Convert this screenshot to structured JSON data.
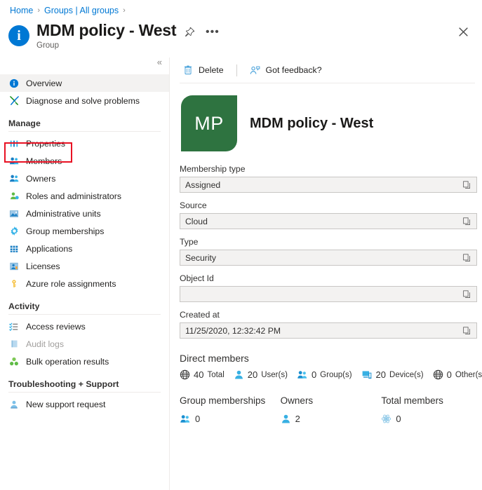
{
  "breadcrumb": {
    "items": [
      {
        "label": "Home",
        "icon": ""
      },
      {
        "label": "Groups | All groups",
        "icon": ""
      }
    ],
    "separator": "›"
  },
  "header": {
    "title": "MDM policy - West",
    "subtitle": "Group",
    "info_icon": "info-icon",
    "pin_icon": "📌",
    "ellipsis_label": "•••",
    "close_label": "✕",
    "collapse_label": "«"
  },
  "sidebar": {
    "items": [
      {
        "label": "Overview",
        "icon": "info-icon",
        "selected": true,
        "disabled": false
      },
      {
        "label": "Diagnose and solve problems",
        "icon": "wrench-icon",
        "selected": false,
        "disabled": false
      }
    ],
    "groups": [
      {
        "title": "Manage",
        "items": [
          {
            "label": "Properties",
            "icon": "properties-icon",
            "highlighted": true,
            "disabled": false
          },
          {
            "label": "Members",
            "icon": "members-icon",
            "highlighted": false,
            "disabled": false
          },
          {
            "label": "Owners",
            "icon": "owners-icon",
            "highlighted": false,
            "disabled": false
          },
          {
            "label": "Roles and administrators",
            "icon": "roles-icon",
            "highlighted": false,
            "disabled": false
          },
          {
            "label": "Administrative units",
            "icon": "admin-units-icon",
            "highlighted": false,
            "disabled": false
          },
          {
            "label": "Group memberships",
            "icon": "gear-icon",
            "highlighted": false,
            "disabled": false
          },
          {
            "label": "Applications",
            "icon": "apps-grid-icon",
            "highlighted": false,
            "disabled": false
          },
          {
            "label": "Licenses",
            "icon": "license-icon",
            "highlighted": false,
            "disabled": false
          },
          {
            "label": "Azure role assignments",
            "icon": "key-icon",
            "highlighted": false,
            "disabled": false
          }
        ]
      },
      {
        "title": "Activity",
        "items": [
          {
            "label": "Access reviews",
            "icon": "checklist-icon",
            "highlighted": false,
            "disabled": false
          },
          {
            "label": "Audit logs",
            "icon": "book-icon",
            "highlighted": false,
            "disabled": true
          },
          {
            "label": "Bulk operation results",
            "icon": "clover-icon",
            "highlighted": false,
            "disabled": false
          }
        ]
      },
      {
        "title": "Troubleshooting + Support",
        "items": [
          {
            "label": "New support request",
            "icon": "support-person-icon",
            "highlighted": false,
            "disabled": false
          }
        ]
      }
    ]
  },
  "toolbar": {
    "delete_label": "Delete",
    "delete_icon": "trash-icon",
    "feedback_label": "Got feedback?",
    "feedback_icon": "feedback-person-icon"
  },
  "group": {
    "initials": "MP",
    "name": "MDM policy - West",
    "avatar_color": "#2e7340"
  },
  "properties": [
    {
      "label": "Membership type",
      "value": "Assigned",
      "copy_icon": "copy-icon"
    },
    {
      "label": "Source",
      "value": "Cloud",
      "copy_icon": "copy-icon"
    },
    {
      "label": "Type",
      "value": "Security",
      "copy_icon": "copy-icon"
    },
    {
      "label": "Object Id",
      "value": "",
      "copy_icon": "copy-icon"
    },
    {
      "label": "Created at",
      "value": "11/25/2020, 12:32:42 PM",
      "copy_icon": "copy-icon"
    }
  ],
  "direct_members": {
    "title": "Direct members",
    "stats": [
      {
        "count": "40",
        "label": "Total",
        "icon": "globe-icon"
      },
      {
        "count": "20",
        "label": "User(s)",
        "icon": "user-icon"
      },
      {
        "count": "0",
        "label": "Group(s)",
        "icon": "group-icon"
      },
      {
        "count": "20",
        "label": "Device(s)",
        "icon": "device-icon"
      },
      {
        "count": "0",
        "label": "Other(s)",
        "icon": "globe-icon"
      }
    ]
  },
  "summary_cards": [
    {
      "title": "Group memberships",
      "value": "0",
      "icon": "group-icon"
    },
    {
      "title": "Owners",
      "value": "2",
      "icon": "user-icon"
    },
    {
      "title": "Total members",
      "value": "0",
      "icon": "atom-icon"
    }
  ],
  "colors": {
    "accent": "#0078d4",
    "highlight": "#e81123",
    "avatar_green": "#2e7340",
    "field_bg": "#f3f2f1"
  }
}
